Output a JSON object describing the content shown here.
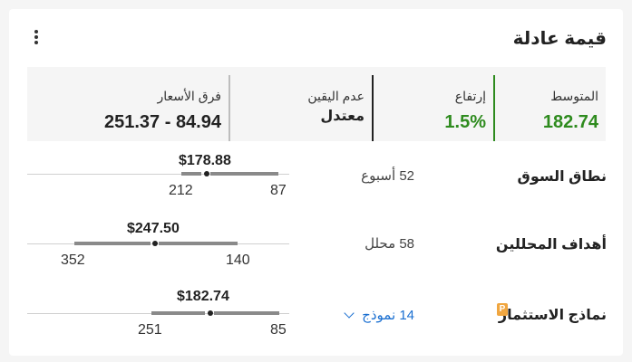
{
  "card": {
    "title": "قيمة عادلة",
    "menu_icon": "more-vertical-icon"
  },
  "stats": [
    {
      "label": "المتوسط",
      "value": "182.74",
      "color": "#2e8b1e"
    },
    {
      "label": "إرتفاع",
      "value": "1.5%",
      "color": "#2e8b1e"
    },
    {
      "label": "عدم اليقين",
      "value": "معتدل",
      "color": "#222222"
    },
    {
      "label": "فرق الأسعار",
      "value": "84.94 - 251.37",
      "color": "#222222"
    }
  ],
  "rows": [
    {
      "label": "نطاق السوق",
      "sub": "52 أسبوع",
      "price": "$178.88",
      "low_label": "87",
      "high_label": "212",
      "range_values": {
        "low": 87,
        "high": 212,
        "marker": 178.88
      }
    },
    {
      "label": "أهداف المحللين",
      "sub": "58 محلل",
      "price": "$247.50",
      "low_label": "140",
      "high_label": "352",
      "range_values": {
        "low": 140,
        "high": 352,
        "marker": 247.5
      }
    },
    {
      "label": "نماذج الاستثمار",
      "badge": "P",
      "badge_color": "#f0a640",
      "sub": "14 نموذج",
      "sub_icon": "chevron-down-icon",
      "price": "$182.74",
      "low_label": "85",
      "high_label": "251",
      "range_values": {
        "low": 85,
        "high": 251,
        "marker": 182.74
      }
    }
  ]
}
